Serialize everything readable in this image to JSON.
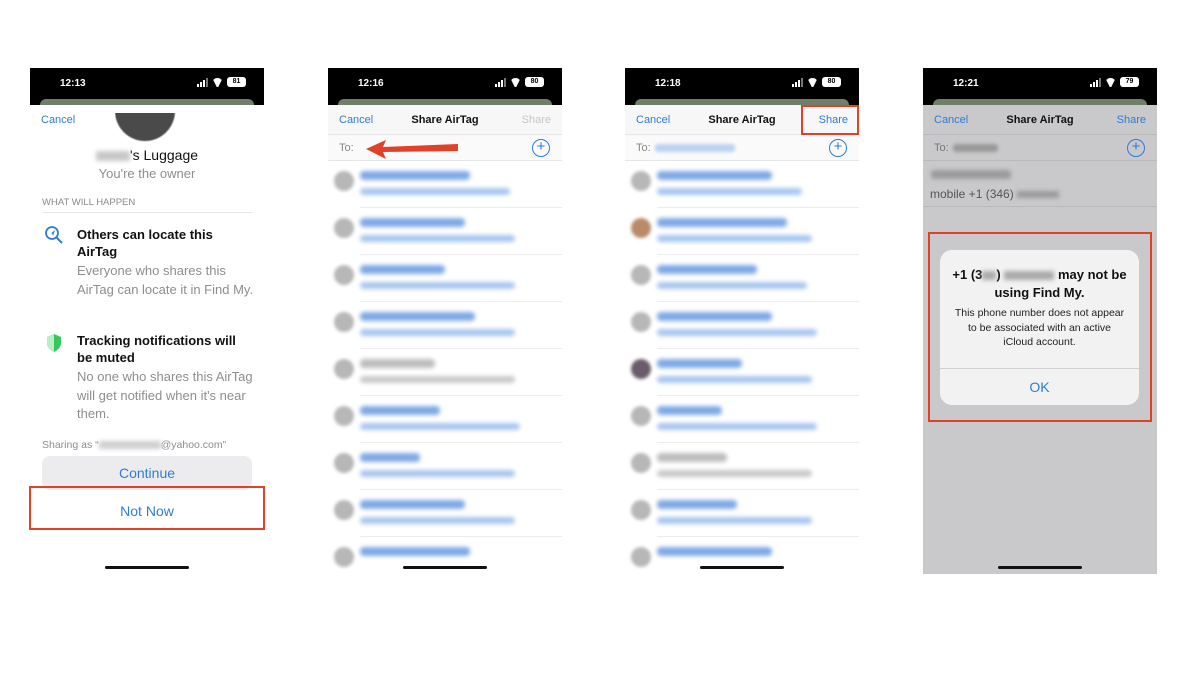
{
  "panel1": {
    "time": "12:13",
    "battery": "81",
    "cancel": "Cancel",
    "owner_suffix": "'s Luggage",
    "owner_line": "You're the owner",
    "section_header": "WHAT WILL HAPPEN",
    "item1_title": "Others can locate this AirTag",
    "item1_body": "Everyone who shares this AirTag can locate it in Find My.",
    "item2_title": "Tracking notifications will be muted",
    "item2_body": "No one who shares this AirTag will get notified when it's near them.",
    "sharing_prefix": "Sharing as “",
    "sharing_suffix": "@yahoo.com”",
    "continue": "Continue",
    "not_now": "Not Now",
    "icon1": "location-search-icon",
    "icon2": "green-shield-icon"
  },
  "panel2": {
    "time": "12:16",
    "battery": "80",
    "cancel": "Cancel",
    "title": "Share AirTag",
    "share": "Share",
    "to_label": "To:"
  },
  "panel3": {
    "time": "12:18",
    "battery": "80",
    "cancel": "Cancel",
    "title": "Share AirTag",
    "share": "Share",
    "to_label": "To:"
  },
  "panel4": {
    "time": "12:21",
    "battery": "79",
    "cancel": "Cancel",
    "title": "Share AirTag",
    "share": "Share",
    "to_label": "To:",
    "mobile_line": "mobile +1 (346)",
    "alert_title_prefix": "+1 (3",
    "alert_title_suffix": "may not be using Find My.",
    "alert_body": "This phone number does not appear to be associated with an active iCloud account.",
    "alert_ok": "OK"
  },
  "colors": {
    "accent": "#2f7bd8",
    "highlight_red": "#e0412b",
    "shield_green": "#34c759"
  }
}
